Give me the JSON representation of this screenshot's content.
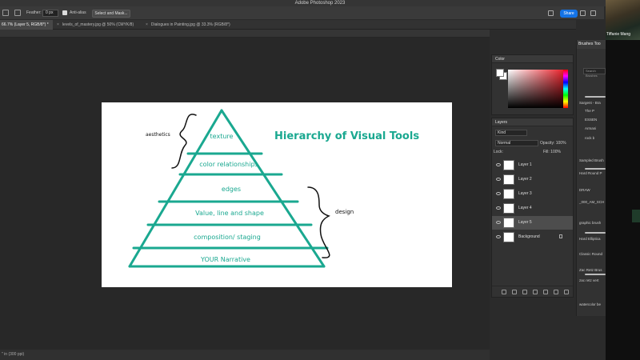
{
  "window": {
    "title": "Adobe Photoshop 2023"
  },
  "options_bar": {
    "feather_label": "Feather:",
    "feather_value": "0 px",
    "antialias_label": "Anti-alias",
    "select_mask_label": "Select and Mask...",
    "share_label": "Share"
  },
  "tabs": [
    {
      "label": "66.7% (Layer 5, RGB/8*) *",
      "active": true
    },
    {
      "label": "levels_of_mastery.jpg @ 50% (CMYK/8)",
      "active": false
    },
    {
      "label": "Dialogues in Painting.jpg @ 33.3% (RGB/8*)",
      "active": false
    }
  ],
  "status_bar": {
    "text": "\" in (300 ppi)"
  },
  "artboard": {
    "title": "Hierarchy of  Visual Tools",
    "accent_color": "#1aa890",
    "levels": [
      "texture",
      "color relationships",
      "edges",
      "Value, line and shape",
      "composition/ staging",
      "YOUR Narrative"
    ],
    "annotation_left": "aesthetics",
    "annotation_right": "design"
  },
  "color_panel": {
    "title": "Color",
    "fg": "#ffffff",
    "hue": "#e8141e"
  },
  "layers_panel": {
    "title": "Layers",
    "kind_label": "Kind",
    "blend_mode": "Normal",
    "opacity_label": "Opacity:",
    "opacity_value": "100%",
    "lock_label": "Lock:",
    "fill_label": "Fill:",
    "fill_value": "100%",
    "layers": [
      {
        "name": "Layer 1",
        "selected": false
      },
      {
        "name": "Layer 2",
        "selected": false
      },
      {
        "name": "Layer 3",
        "selected": false
      },
      {
        "name": "Layer 4",
        "selected": false
      },
      {
        "name": "Layer 5",
        "selected": true
      },
      {
        "name": "Background",
        "selected": false,
        "locked": true
      }
    ]
  },
  "brushes_panel": {
    "tabs": "Brushes  Too",
    "search_placeholder": "Search Brushes",
    "items": [
      "Sargent - Bra",
      "The P",
      "ESSEN",
      "Armani",
      "rock b",
      "Sampled Brush",
      "Hard Round P",
      "DRAW",
      "_000_AM_SCH",
      "graphic brush",
      "Hard Elliptica",
      "Classic Round",
      "Zac Retz Brus",
      "zac retz vert",
      "watercolor be"
    ]
  },
  "video": {
    "participant_name": "Tiffanie Mang"
  }
}
